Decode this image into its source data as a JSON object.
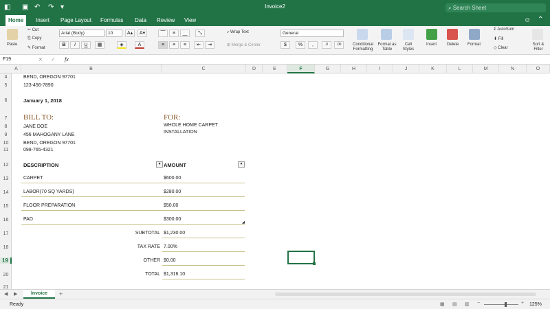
{
  "window": {
    "title": "Invoice2",
    "search_placeholder": "Search Sheet"
  },
  "tabs": [
    "Home",
    "Insert",
    "Page Layout",
    "Formulas",
    "Data",
    "Review",
    "View"
  ],
  "ribbon": {
    "paste": "Paste",
    "cut": "Cut",
    "copy": "Copy",
    "format": "Format",
    "font": "Arial (Body)",
    "size": "10",
    "bold": "B",
    "italic": "I",
    "underline": "U",
    "wrap": "Wrap Text",
    "merge": "Merge & Center",
    "number_format": "General",
    "cond": "Conditional Formatting",
    "fmt_table": "Format as Table",
    "cell_styles": "Cell Styles",
    "insert": "Insert",
    "delete": "Delete",
    "format2": "Format",
    "autosum": "AutoSum",
    "fill": "Fill",
    "clear": "Clear",
    "sort": "Sort & Filter"
  },
  "formula_bar": {
    "name_box": "F19",
    "fx": "fx",
    "content": ""
  },
  "columns": [
    "A",
    "B",
    "C",
    "D",
    "E",
    "F",
    "G",
    "H",
    "I",
    "J",
    "K",
    "L",
    "M",
    "N",
    "O"
  ],
  "rows": [
    "4",
    "5",
    "6",
    "7",
    "8",
    "9",
    "10",
    "11",
    "12",
    "13",
    "14",
    "15",
    "16",
    "17",
    "18",
    "19",
    "20",
    "21"
  ],
  "cells": {
    "r4": "BEND, OREGON 97701",
    "r5": "123-456-7890",
    "date": "January 1, 2018",
    "bill_to": "BILL TO:",
    "for": "FOR:",
    "name": "JANE DOE",
    "addr": "456 MAHOGANY LANE",
    "city": "BEND, OREGON 97701",
    "phone": "098-765-4321",
    "for_desc1": "WHOLE HOME CARPET",
    "for_desc2": "INSTALLATION",
    "desc_hdr": "DESCRIPTION",
    "amt_hdr": "AMOUNT",
    "items": [
      {
        "desc": "CARPET",
        "amt": "$600.00"
      },
      {
        "desc": "LABOR(70 SQ YARDS)",
        "amt": "$280.00"
      },
      {
        "desc": "FLOOR PREPARATION",
        "amt": "$50.00"
      },
      {
        "desc": "PAD",
        "amt": "$300.00"
      }
    ],
    "subtotal_label": "SUBTOTAL",
    "subtotal": "$1,230.00",
    "tax_label": "TAX RATE",
    "tax": "7.00%",
    "other_label": "OTHER",
    "other": "$0.00",
    "total_label": "TOTAL",
    "total": "$1,316.10"
  },
  "sheet_tab": "Invoice",
  "add_sheet": "+",
  "status": {
    "ready": "Ready",
    "zoom": "125%",
    "zoom_level": 0.6
  },
  "colors": {
    "green": "#217346",
    "title_brown": "#8a5a2b"
  }
}
